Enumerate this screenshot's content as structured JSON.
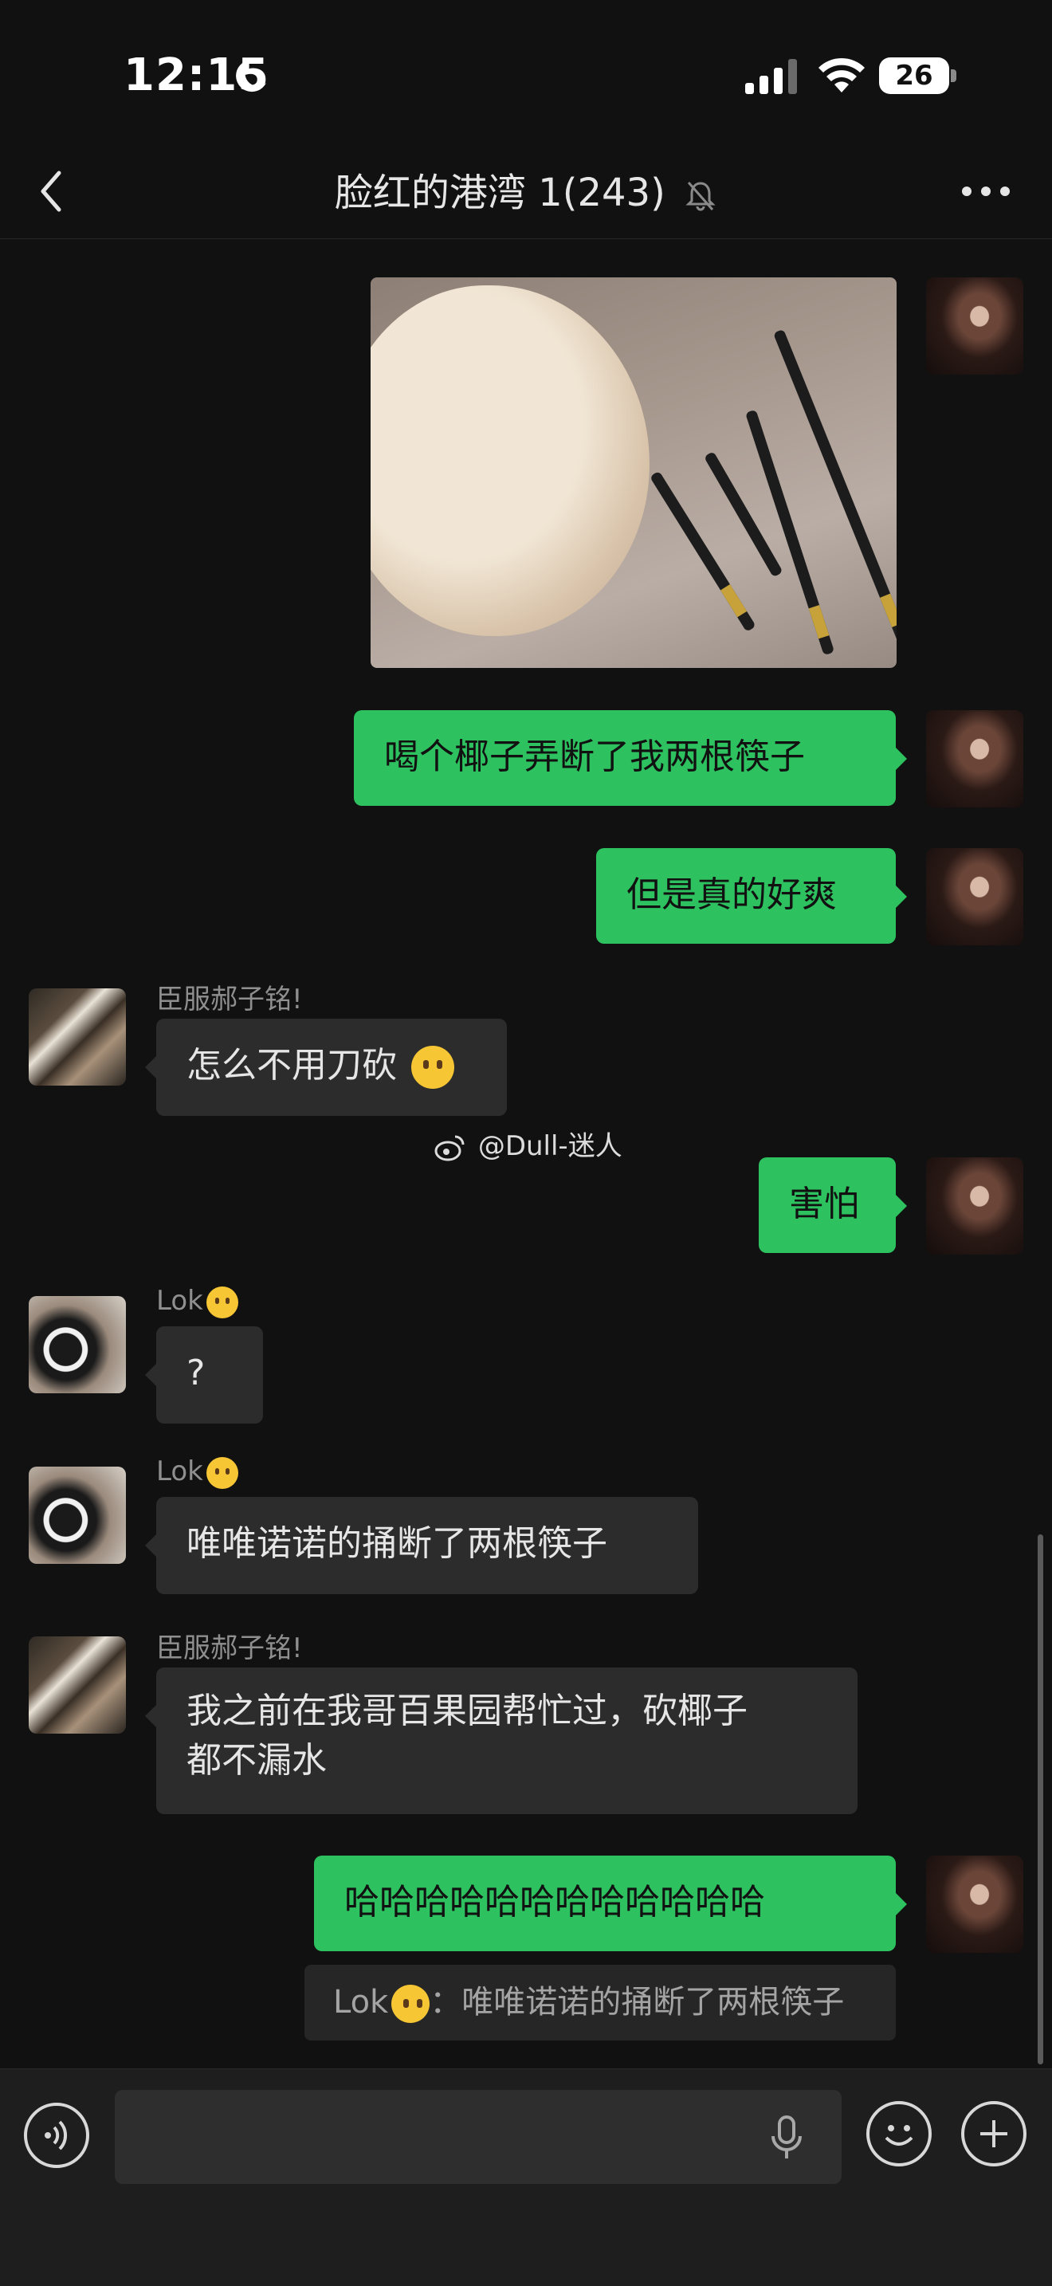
{
  "status_bar": {
    "time": "12:15",
    "battery": "26"
  },
  "nav": {
    "title": "脸红的港湾 1(243)"
  },
  "messages": {
    "m1_image_alt": "coconut and broken chopsticks photo",
    "m2": "喝个椰子弄断了我两根筷子",
    "m3": "但是真的好爽",
    "m4_sender": "臣服郝子铭!",
    "m4": "怎么不用刀砍",
    "m5": "害怕",
    "m6_sender": "Lok",
    "m6": "?",
    "m7_sender": "Lok",
    "m7": "唯唯诺诺的捅断了两根筷子",
    "m8_sender": "臣服郝子铭!",
    "m8_line1": "我之前在我哥百果园帮忙过，砍椰子",
    "m8_line2": "都不漏水",
    "m9": "哈哈哈哈哈哈哈哈哈哈哈哈",
    "quote_sender": "Lok",
    "quote_sep": "：",
    "quote_text": "唯唯诺诺的捅断了两根筷子"
  },
  "watermark": "@Dull-迷人",
  "input": {
    "placeholder": ""
  },
  "icons": [
    "moon-icon",
    "signal-icon",
    "wifi-icon",
    "back-icon",
    "mute-bell-icon",
    "more-icon",
    "voice-icon",
    "mic-icon",
    "emoji-icon",
    "plus-icon",
    "weibo-icon"
  ],
  "colors": {
    "background": "#111111",
    "green_bubble": "#2dc160",
    "gray_bubble": "#2c2c2c"
  }
}
